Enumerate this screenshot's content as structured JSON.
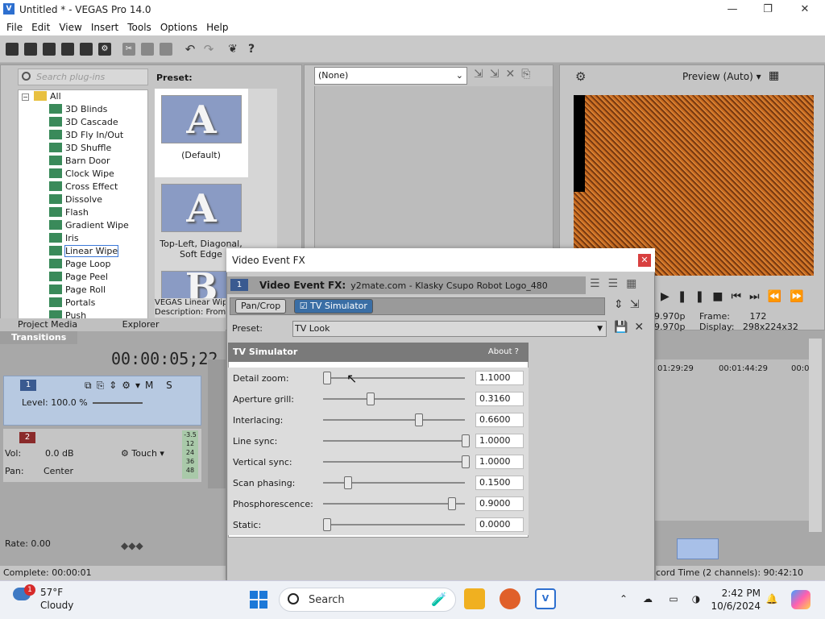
{
  "app": {
    "title": "Untitled * - VEGAS Pro 14.0",
    "menu": [
      "File",
      "Edit",
      "View",
      "Insert",
      "Tools",
      "Options",
      "Help"
    ]
  },
  "browser": {
    "search_placeholder": "Search plug-ins",
    "root_label": "All",
    "items": [
      "3D Blinds",
      "3D Cascade",
      "3D Fly In/Out",
      "3D Shuffle",
      "Barn Door",
      "Clock Wipe",
      "Cross Effect",
      "Dissolve",
      "Flash",
      "Gradient Wipe",
      "Iris",
      "Linear Wipe",
      "Page Loop",
      "Page Peel",
      "Page Roll",
      "Portals",
      "Push"
    ],
    "selected_item": "Linear Wipe",
    "preset_label": "Preset:",
    "presets": [
      {
        "glyph": "A",
        "caption": "(Default)"
      },
      {
        "glyph": "A",
        "caption": "Top-Left, Diagonal, Soft Edge"
      },
      {
        "glyph": "B",
        "caption": ""
      }
    ],
    "description": "VEGAS Linear Wipe\nDescription: From",
    "tabs": [
      "Project Media",
      "Explorer",
      "Transitions"
    ],
    "active_tab": "Transitions"
  },
  "trimmer": {
    "select_value": "(None)"
  },
  "preview": {
    "mode": "Preview (Auto)",
    "frame_label": "Frame:",
    "frame_value": "172",
    "display_label": "Display:",
    "display_value": "298x224x32",
    "fps1": "9.970p",
    "fps2": "9.970p"
  },
  "timeline": {
    "timecode": "00:00:05;22",
    "track1": {
      "number": "1",
      "level": "Level: 100.0 %"
    },
    "track2": {
      "number": "2",
      "vol_label": "Vol:",
      "vol_value": "0.0 dB",
      "pan_label": "Pan:",
      "pan_value": "Center",
      "mode": "Touch",
      "meter": [
        "-3.5",
        "12",
        "24",
        "36",
        "48"
      ]
    },
    "ruler": [
      "01:29:29",
      "00:01:44:29",
      "00:0"
    ],
    "rate": "Rate: 0.00",
    "status": "Complete: 00:00:01",
    "record_time": "cord Time (2 channels): 90:42:10"
  },
  "dialog": {
    "title": "Video Event FX",
    "fx_label": "Video Event FX:",
    "fx_value": "y2mate.com - Klasky Csupo Robot Logo_480",
    "track_num": "1",
    "chain": [
      "Pan/Crop",
      "TV Simulator"
    ],
    "preset_label": "Preset:",
    "preset_value": "TV Look",
    "plugin_name": "TV Simulator",
    "about_label": "About",
    "params": [
      {
        "label": "Detail zoom:",
        "value": "1.1000",
        "fraction": 0.0
      },
      {
        "label": "Aperture grill:",
        "value": "0.3160",
        "fraction": 0.316
      },
      {
        "label": "Interlacing:",
        "value": "0.6600",
        "fraction": 0.66
      },
      {
        "label": "Line sync:",
        "value": "1.0000",
        "fraction": 1.0
      },
      {
        "label": "Vertical sync:",
        "value": "1.0000",
        "fraction": 1.0
      },
      {
        "label": "Scan phasing:",
        "value": "0.1500",
        "fraction": 0.15
      },
      {
        "label": "Phosphorescence:",
        "value": "0.9000",
        "fraction": 0.9
      },
      {
        "label": "Static:",
        "value": "0.0000",
        "fraction": 0.0
      }
    ]
  },
  "taskbar": {
    "weather_temp": "57°F",
    "weather_cond": "Cloudy",
    "weather_badge": "1",
    "search_label": "Search",
    "time": "2:42 PM",
    "date": "10/6/2024"
  },
  "colors": {
    "accent": "#3a6ea5",
    "preview_noise": "#b8561b",
    "track1": "#b7c9e1"
  }
}
